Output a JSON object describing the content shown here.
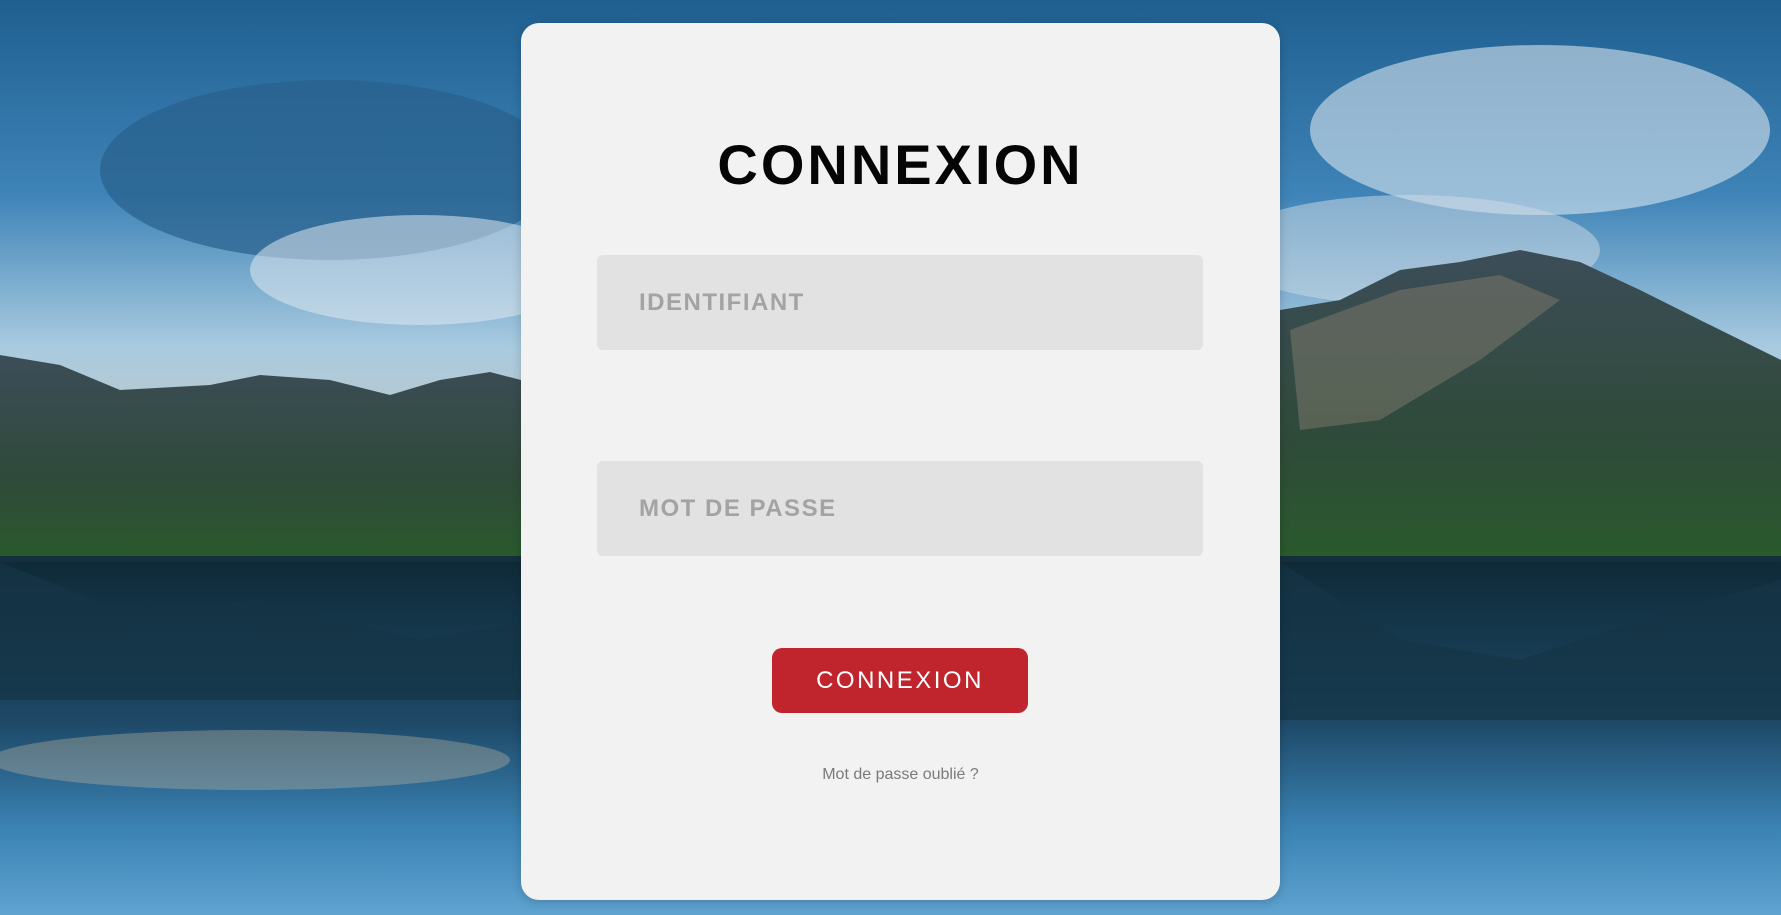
{
  "login": {
    "title": "CONNEXION",
    "username_placeholder": "IDENTIFIANT",
    "password_placeholder": "MOT DE PASSE",
    "submit_label": "CONNEXION",
    "forgot_link": "Mot de passe oublié ?"
  },
  "colors": {
    "card_background": "#f2f2f2",
    "input_background": "#e2e2e2",
    "button_background": "#c0242c",
    "button_text": "#ffffff",
    "title_text": "#050505"
  },
  "background": {
    "description_icon": "mountain-lake-photo"
  }
}
